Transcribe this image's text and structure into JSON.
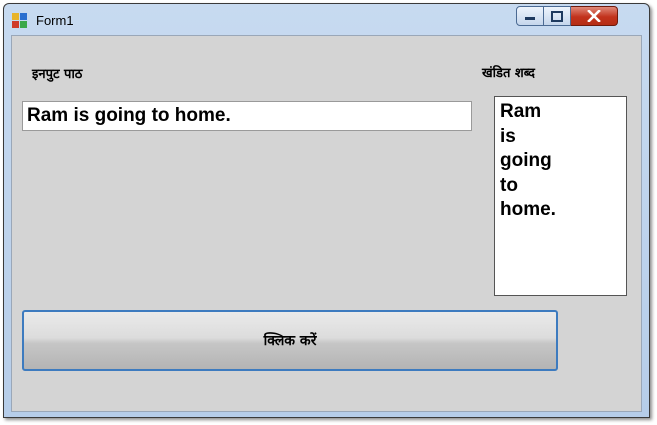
{
  "window": {
    "title": "Form1",
    "controls": [
      "minimize-icon",
      "maximize-icon",
      "close-icon"
    ]
  },
  "labels": {
    "input_text": "इनपुट पाठ",
    "split_words": "खंडित शब्द"
  },
  "input": {
    "value": "Ram is going to home."
  },
  "word_list": [
    "Ram",
    "is",
    "going",
    "to",
    "home."
  ],
  "button": {
    "label": "क्लिक करें"
  },
  "colors": {
    "client_bg": "#d4d4d4",
    "title_bar": "#c7daf0",
    "close_button": "#c2331d",
    "button_border": "#3d7bbf"
  }
}
